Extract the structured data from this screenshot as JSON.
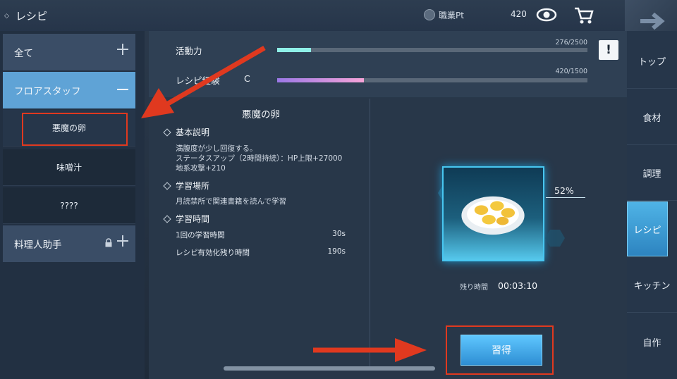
{
  "header": {
    "title": "レシピ",
    "job_label": "職業Pt",
    "job_value": "420"
  },
  "sidebar": {
    "items": [
      {
        "label": "全て"
      },
      {
        "label": "フロアスタッフ"
      },
      {
        "label": "料理人助手"
      }
    ],
    "sub_items": [
      {
        "label": "悪魔の卵"
      },
      {
        "label": "味噌汁"
      },
      {
        "label": "????"
      }
    ]
  },
  "stats": {
    "vitality": {
      "label": "活動力",
      "count": "276/2500",
      "fill": 0.11,
      "color": "#8ff0e8"
    },
    "recipe": {
      "label": "レシピ経験",
      "grade": "C",
      "count": "420/1500",
      "fill": 0.28,
      "color_start": "#9b78e6",
      "color_end": "#f6a4d8"
    },
    "alert_glyph": "!"
  },
  "detail": {
    "title": "悪魔の卵",
    "basic": {
      "heading": "基本説明",
      "lines": [
        "満腹度が少し回復する。",
        "ステータスアップ（2時間持続）：HP上限+27000",
        "地系攻撃+210"
      ]
    },
    "place": {
      "heading": "学習場所",
      "text": "月読禁所で関連書籍を読んで学習"
    },
    "time": {
      "heading": "学習時間",
      "rows": [
        {
          "label": "1回の学習時間",
          "value": "30s"
        },
        {
          "label": "レシピ有効化残り時間",
          "value": "190s"
        }
      ]
    }
  },
  "progress": {
    "percent": "52%",
    "remain_label": "残り時間",
    "remain_value": "00:03:10"
  },
  "action": {
    "learn_label": "習得"
  },
  "tabs": [
    {
      "label": "トップ"
    },
    {
      "label": "食材"
    },
    {
      "label": "調理"
    },
    {
      "label": "レシピ"
    },
    {
      "label": "キッチン"
    },
    {
      "label": "自作"
    }
  ],
  "colors": {
    "accent": "#5fa3d6",
    "highlight": "#e0391f",
    "button": "#3aa3e6"
  }
}
